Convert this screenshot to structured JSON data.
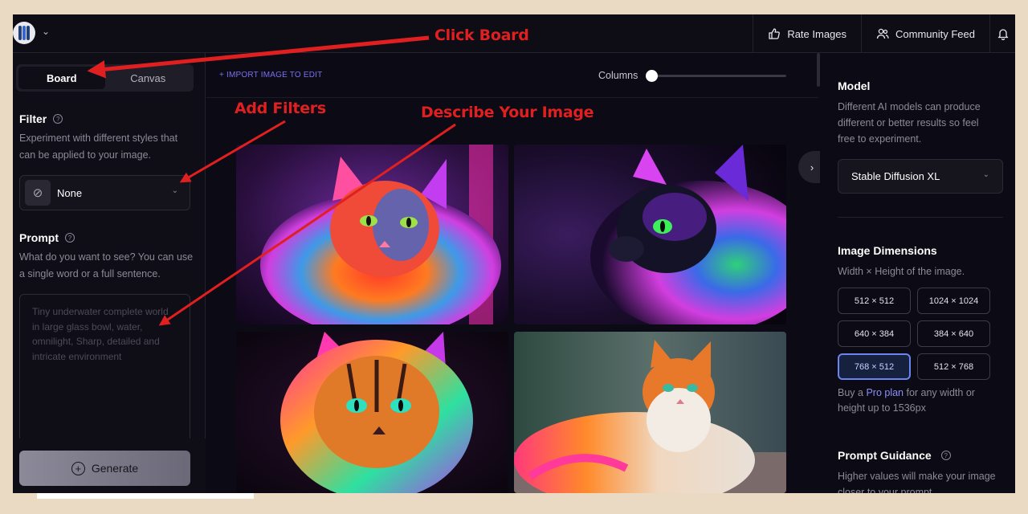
{
  "colors": {
    "page_background": "#ead9c3",
    "app_background": "#0c0a14",
    "accent": "#7a6ff0",
    "selected_dimension": "#6a86ee",
    "annotation": "#e02020"
  },
  "header": {
    "logo_icon": "circle-stripes-logo",
    "nav": [
      {
        "label": "Rate Images",
        "icon": "thumbs-up-icon"
      },
      {
        "label": "Community Feed",
        "icon": "users-icon"
      },
      {
        "label": "",
        "icon": "bell-icon"
      }
    ]
  },
  "sidebar": {
    "tabs": [
      {
        "label": "Board",
        "active": true
      },
      {
        "label": "Canvas",
        "active": false
      }
    ],
    "filter": {
      "title": "Filter",
      "description": "Experiment with different styles that can be applied to your image.",
      "selected": "None"
    },
    "prompt": {
      "title": "Prompt",
      "description": "What do you want to see? You can use a single word or a full sentence.",
      "placeholder": "Tiny underwater complete world in large glass bowl, water, omnilight, Sharp, detailed and intricate environment"
    },
    "generate_label": "Generate"
  },
  "main": {
    "import_label": "+ IMPORT IMAGE TO EDIT",
    "columns_label": "Columns",
    "columns_value": 0,
    "images": [
      {
        "subject": "neon multicolor fluffy cat facing forward"
      },
      {
        "subject": "neon cat in profile with green eyes"
      },
      {
        "subject": "rainbow striped cat portrait"
      },
      {
        "subject": "orange and white fluffy cat lying down"
      }
    ]
  },
  "right_panel": {
    "model": {
      "title": "Model",
      "description": "Different AI models can produce different or better results so feel free to experiment.",
      "selected": "Stable Diffusion XL"
    },
    "dimensions": {
      "title": "Image Dimensions",
      "description": "Width × Height of the image.",
      "options": [
        "512 × 512",
        "1024 × 1024",
        "640 × 384",
        "384 × 640",
        "768 × 512",
        "512 × 768"
      ],
      "selected": "768 × 512"
    },
    "pro_text_before": "Buy a ",
    "pro_link": "Pro plan",
    "pro_text_after": " for any width or height up to 1536px",
    "guidance": {
      "title": "Prompt Guidance",
      "description": "Higher values will make your image closer to your prompt"
    }
  },
  "annotations": {
    "click_board": "Click Board",
    "add_filters": "Add Filters",
    "describe_image": "Describe Your Image"
  }
}
